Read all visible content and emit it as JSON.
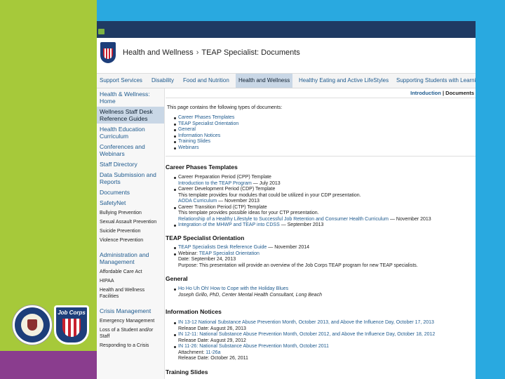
{
  "header": {
    "section": "Health and Wellness",
    "separator": "›",
    "page": "TEAP Specialist: Documents"
  },
  "tabs": [
    "Support Services",
    "Disability",
    "Food and Nutrition",
    "Health and Wellness",
    "Healthy Eating and Active LifeStyles",
    "Supporting Students with Learni"
  ],
  "sidebar": [
    {
      "label": "Health & Wellness: Home",
      "type": "item"
    },
    {
      "label": "Wellness Staff Desk Reference Guides",
      "type": "active"
    },
    {
      "label": "Health Education Curriculum",
      "type": "item"
    },
    {
      "label": "Conferences and Webinars",
      "type": "item"
    },
    {
      "label": "Staff Directory",
      "type": "item"
    },
    {
      "label": "Data Submission and Reports",
      "type": "item"
    },
    {
      "label": "Documents",
      "type": "item"
    },
    {
      "label": "SafetyNet",
      "type": "item"
    },
    {
      "label": "Bullying Prevention",
      "type": "sub"
    },
    {
      "label": "Sexual Assault Prevention",
      "type": "sub"
    },
    {
      "label": "Suicide Prevention",
      "type": "sub"
    },
    {
      "label": "Violence Prevention",
      "type": "sub"
    },
    {
      "label": "Administration and Management",
      "type": "item"
    },
    {
      "label": "Affordable Care Act",
      "type": "sub"
    },
    {
      "label": "HIPAA",
      "type": "sub"
    },
    {
      "label": "Health and Wellness Facilities",
      "type": "sub"
    },
    {
      "label": "Crisis Management",
      "type": "item"
    },
    {
      "label": "Emergency Management",
      "type": "sub"
    },
    {
      "label": "Loss of a Student and/or Staff",
      "type": "sub"
    },
    {
      "label": "Responding to a Crisis",
      "type": "sub"
    }
  ],
  "crumbs": {
    "intro": "Introduction",
    "sep": "|",
    "current": "Documents"
  },
  "intro_text": "This page contains the following types of documents:",
  "toc": [
    "Career Phases Templates",
    "TEAP Specialist Orientation",
    "General",
    "Information Notices",
    "Training Slides",
    "Webinars"
  ],
  "sections": {
    "career": {
      "title": "Career Phases Templates",
      "items": [
        {
          "lines": [
            [
              "",
              "Career Preparation Period (CPP) Template"
            ],
            [
              "link",
              "Introduction to the TEAP Program",
              " — July 2013"
            ]
          ]
        },
        {
          "lines": [
            [
              "",
              "Career Development Period (CDP) Template"
            ],
            [
              "",
              "This template provides four modules that could be utilized in your CDP presentation."
            ],
            [
              "link",
              "AODA Curriculum",
              " — November 2013"
            ]
          ]
        },
        {
          "lines": [
            [
              "",
              "Career Transition Period (CTP) Template"
            ],
            [
              "",
              "This template provides possible ideas for your CTP presentation."
            ],
            [
              "link",
              "Relationship of a Healthy Lifestyle to Successful Job Retention and Consumer Health Curriculum",
              " — November 2013"
            ]
          ]
        },
        {
          "lines": [
            [
              "link",
              "Integration of the MHWP and TEAP into CDSS",
              " — September 2013"
            ]
          ]
        }
      ]
    },
    "orientation": {
      "title": "TEAP Specialist Orientation",
      "items": [
        {
          "lines": [
            [
              "link",
              "TEAP Specialists Desk Reference Guide",
              " — November 2014"
            ]
          ]
        },
        {
          "lines": [
            [
              "mixed",
              "Webinar: ",
              "TEAP Specialist Orientation"
            ],
            [
              "",
              "Date: September 24, 2013"
            ],
            [
              "",
              "Purpose: This presentation will provide an overview of the Job Corps TEAP program for new TEAP specialists."
            ]
          ]
        }
      ]
    },
    "general": {
      "title": "General",
      "items": [
        {
          "lines": [
            [
              "link",
              "Ho Ho Uh Oh! How to Cope with the Holiday Blues",
              ""
            ],
            [
              "italic",
              "Joseph Grillo, PhD, Center Mental Health Consultant, Long Beach"
            ]
          ]
        }
      ]
    },
    "notices": {
      "title": "Information Notices",
      "items": [
        {
          "lines": [
            [
              "link",
              "IN 13-12 National Substance Abuse Prevention Month, October 2013, and Above the Influence Day, October 17, 2013",
              ""
            ],
            [
              "",
              "Release Date: August 26, 2013"
            ]
          ]
        },
        {
          "lines": [
            [
              "link",
              "IN 12-11: National Substance Abuse Prevention Month, October 2012, and Above the Influence Day, October 18, 2012",
              ""
            ],
            [
              "",
              "Release Date: August 29, 2012"
            ]
          ]
        },
        {
          "lines": [
            [
              "link",
              "IN 11-26: National Substance Abuse Prevention Month, October 2011",
              ""
            ],
            [
              "mixed",
              "Attachment: ",
              "11-26a"
            ],
            [
              "",
              "Release Date: October 26, 2011"
            ]
          ]
        }
      ]
    },
    "training": {
      "title": "Training Slides"
    }
  }
}
